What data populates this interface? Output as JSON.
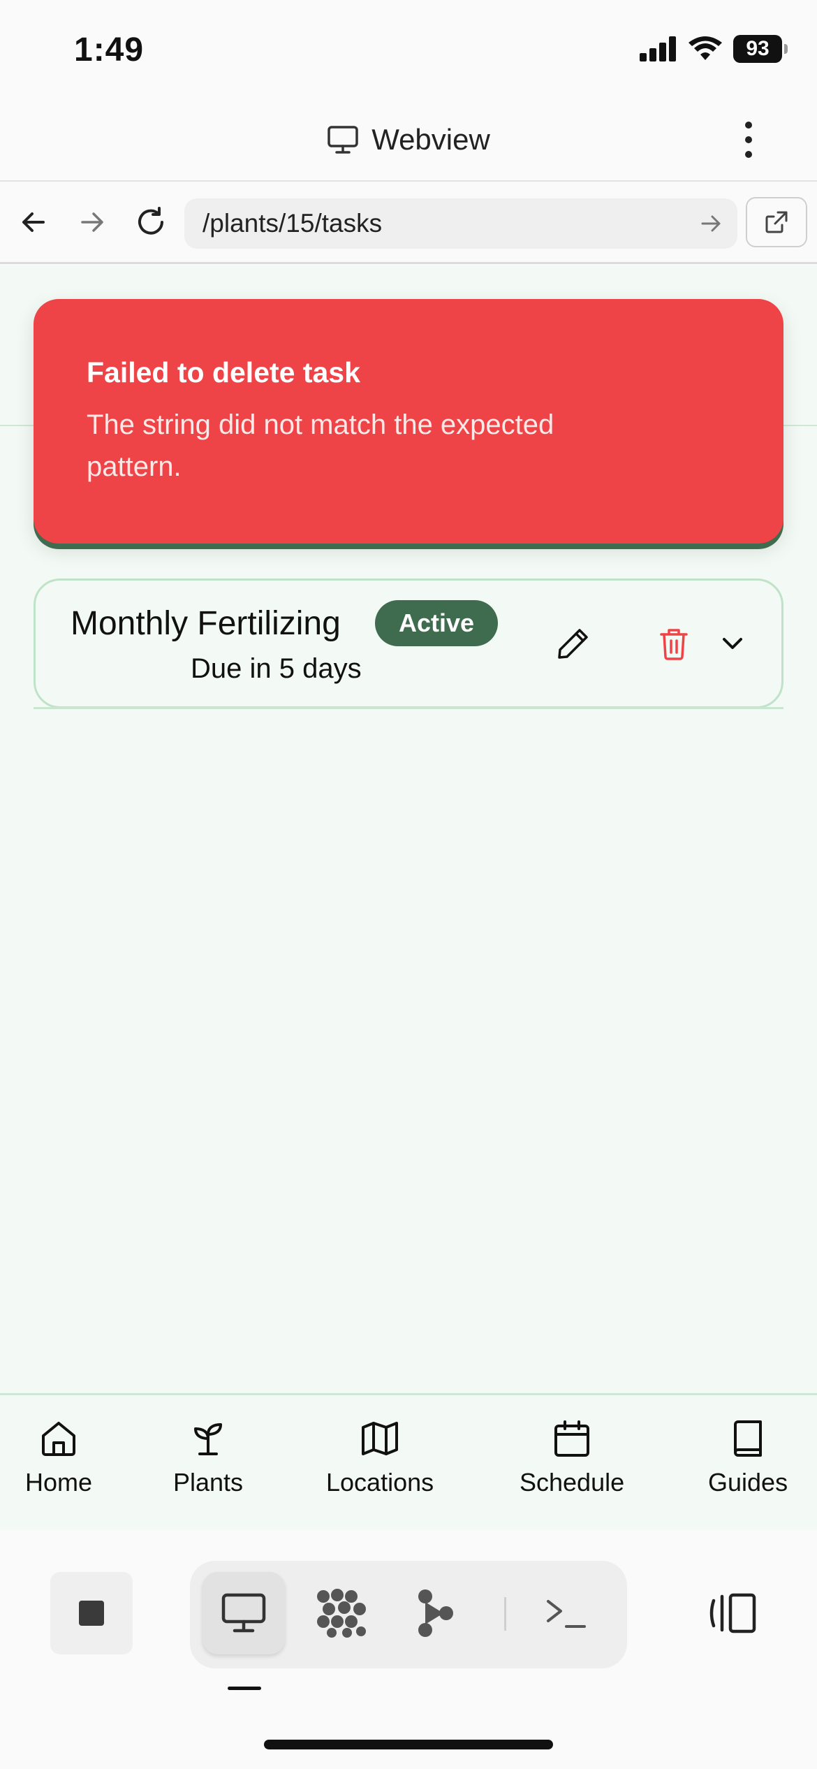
{
  "status_bar": {
    "time": "1:49",
    "battery": "93"
  },
  "webview": {
    "title": "Webview",
    "url": "/plants/15/tasks"
  },
  "toast": {
    "title": "Failed to delete task",
    "message": "The string did not match the expected pattern.",
    "color": "#ef4447"
  },
  "task": {
    "name": "Monthly Fertilizing",
    "status": "Active",
    "due": "Due in 5 days",
    "badge_color": "#3f6b4e"
  },
  "bottom_nav": {
    "items": [
      {
        "label": "Home",
        "icon": "home-icon"
      },
      {
        "label": "Plants",
        "icon": "sprout-icon"
      },
      {
        "label": "Locations",
        "icon": "map-icon"
      },
      {
        "label": "Schedule",
        "icon": "calendar-icon"
      },
      {
        "label": "Guides",
        "icon": "book-icon"
      }
    ]
  },
  "dev_toolbar": {
    "icons": [
      "stop-icon",
      "monitor-icon",
      "dots-grid-icon",
      "branch-icon",
      "terminal-icon",
      "side-panel-icon"
    ]
  },
  "colors": {
    "background": "#f3f9f4",
    "accent": "#3f6b4e",
    "danger": "#ef4447"
  }
}
